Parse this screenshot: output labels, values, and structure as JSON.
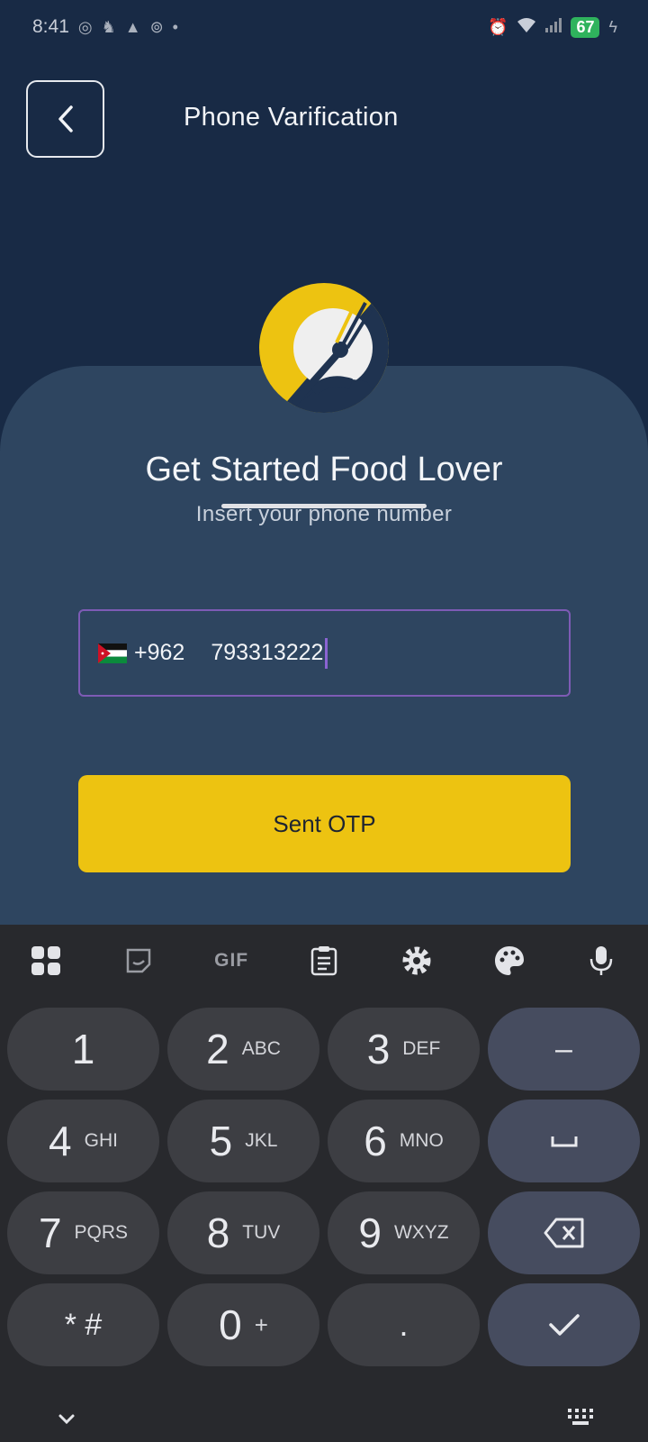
{
  "status": {
    "time": "8:41",
    "battery": "67"
  },
  "header": {
    "title": "Phone Varification"
  },
  "main": {
    "title": "Get Started Food Lover",
    "subtitle": "Insert your phone number"
  },
  "phone": {
    "country_code": "+962",
    "number": "793313222"
  },
  "otp_button": {
    "label": "Sent OTP"
  },
  "keyboard": {
    "toolbar": [
      "apps-icon",
      "sticker-icon",
      "GIF",
      "clipboard-icon",
      "settings-icon",
      "palette-icon",
      "microphone-icon"
    ],
    "gif_label": "GIF",
    "keys": [
      {
        "num": "1",
        "letters": ""
      },
      {
        "num": "2",
        "letters": "ABC"
      },
      {
        "num": "3",
        "letters": "DEF"
      },
      {
        "num": "4",
        "letters": "GHI"
      },
      {
        "num": "5",
        "letters": "JKL"
      },
      {
        "num": "6",
        "letters": "MNO"
      },
      {
        "num": "7",
        "letters": "PQRS"
      },
      {
        "num": "8",
        "letters": "TUV"
      },
      {
        "num": "9",
        "letters": "WXYZ"
      },
      {
        "num": "* #",
        "letters": ""
      },
      {
        "num": "0",
        "letters": "+"
      },
      {
        "num": ".",
        "letters": ""
      }
    ],
    "fn_keys": {
      "minus": "–"
    }
  },
  "colors": {
    "background": "#182a45",
    "card": "#2e4560",
    "accent": "#edc311",
    "field_border": "#7e5bb5"
  }
}
